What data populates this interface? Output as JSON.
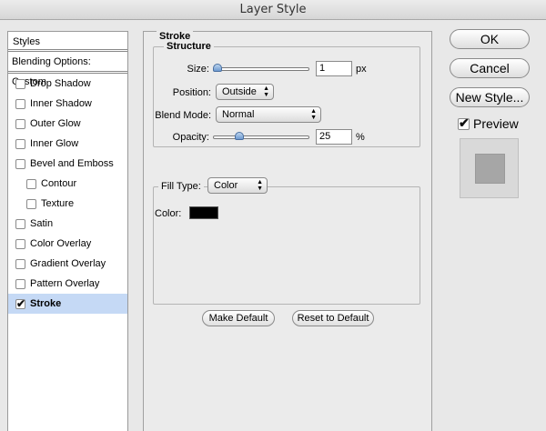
{
  "window": {
    "title": "Layer Style"
  },
  "sidebar": {
    "header": "Styles",
    "blending": "Blending Options: Custom",
    "items": [
      {
        "label": "Drop Shadow",
        "checked": false,
        "sub": false
      },
      {
        "label": "Inner Shadow",
        "checked": false,
        "sub": false
      },
      {
        "label": "Outer Glow",
        "checked": false,
        "sub": false
      },
      {
        "label": "Inner Glow",
        "checked": false,
        "sub": false
      },
      {
        "label": "Bevel and Emboss",
        "checked": false,
        "sub": false
      },
      {
        "label": "Contour",
        "checked": false,
        "sub": true
      },
      {
        "label": "Texture",
        "checked": false,
        "sub": true
      },
      {
        "label": "Satin",
        "checked": false,
        "sub": false
      },
      {
        "label": "Color Overlay",
        "checked": false,
        "sub": false
      },
      {
        "label": "Gradient Overlay",
        "checked": false,
        "sub": false
      },
      {
        "label": "Pattern Overlay",
        "checked": false,
        "sub": false
      },
      {
        "label": "Stroke",
        "checked": true,
        "sub": false,
        "selected": true
      }
    ]
  },
  "stroke": {
    "title": "Stroke",
    "structure_title": "Structure",
    "size_label": "Size:",
    "size_value": "1",
    "size_unit": "px",
    "size_level": 0.0,
    "position_label": "Position:",
    "position_value": "Outside",
    "blend_label": "Blend Mode:",
    "blend_value": "Normal",
    "opacity_label": "Opacity:",
    "opacity_value": "25",
    "opacity_unit": "%",
    "opacity_level": 0.25,
    "fill_type_label": "Fill Type:",
    "fill_type_value": "Color",
    "color_label": "Color:",
    "color_value": "#000000",
    "make_default": "Make Default",
    "reset_default": "Reset to Default"
  },
  "buttons": {
    "ok": "OK",
    "cancel": "Cancel",
    "new_style": "New Style...",
    "preview": "Preview",
    "preview_checked": true
  },
  "icons": {
    "popup_arrows": "up-down-arrows-icon",
    "checkmark": "checkmark-icon"
  }
}
